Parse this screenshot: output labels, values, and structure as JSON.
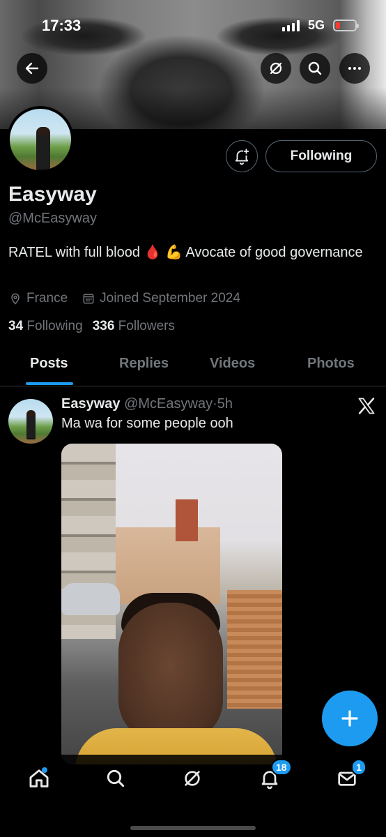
{
  "status_bar": {
    "time": "17:33",
    "network": "5G",
    "battery_level": 0.1,
    "battery_color": "#ff3b30"
  },
  "header": {
    "back_icon": "arrow-left-icon",
    "grok_icon": "slash-circle-icon",
    "search_icon": "search-icon",
    "more_icon": "ellipsis-icon"
  },
  "profile": {
    "name": "Easyway",
    "handle": "@McEasyway",
    "bio": "RATEL with full blood 🩸 💪 Avocate of good governance",
    "location": "France",
    "joined": "Joined September 2024",
    "following_count": "34",
    "following_label": "Following",
    "followers_count": "336",
    "followers_label": "Followers",
    "follow_button_label": "Following"
  },
  "tabs": [
    {
      "label": "Posts",
      "active": true
    },
    {
      "label": "Replies",
      "active": false
    },
    {
      "label": "Videos",
      "active": false
    },
    {
      "label": "Photos",
      "active": false
    }
  ],
  "post": {
    "author": "Easyway",
    "handle": "@McEasyway",
    "separator": "·",
    "time": "5h",
    "text": "Ma wa for some people ooh"
  },
  "bottom_nav": {
    "home_icon": "home-icon",
    "search_icon": "search-icon",
    "grok_icon": "slash-circle-icon",
    "notifications_icon": "bell-icon",
    "notifications_badge": "18",
    "messages_icon": "envelope-icon",
    "messages_badge": "1"
  },
  "colors": {
    "accent": "#1d9bf0",
    "background": "#000000",
    "text_primary": "#e7e9ea",
    "text_secondary": "#71767b"
  }
}
